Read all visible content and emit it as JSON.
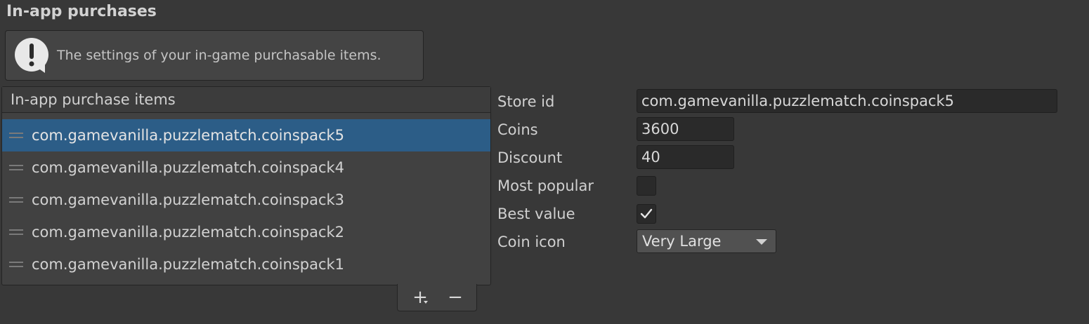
{
  "section": {
    "title": "In-app purchases"
  },
  "help": {
    "icon": "exclamation-speech-bubble-icon",
    "message": "The settings of your in-game purchasable items."
  },
  "list": {
    "header": "In-app purchase items",
    "items": [
      {
        "label": "com.gamevanilla.puzzlematch.coinspack5",
        "selected": true
      },
      {
        "label": "com.gamevanilla.puzzlematch.coinspack4",
        "selected": false
      },
      {
        "label": "com.gamevanilla.puzzlematch.coinspack3",
        "selected": false
      },
      {
        "label": "com.gamevanilla.puzzlematch.coinspack2",
        "selected": false
      },
      {
        "label": "com.gamevanilla.puzzlematch.coinspack1",
        "selected": false
      }
    ],
    "add_label": "+",
    "remove_label": "−"
  },
  "details": {
    "store_id": {
      "label": "Store id",
      "value": "com.gamevanilla.puzzlematch.coinspack5"
    },
    "coins": {
      "label": "Coins",
      "value": "3600"
    },
    "discount": {
      "label": "Discount",
      "value": "40"
    },
    "most_popular": {
      "label": "Most popular",
      "checked": false
    },
    "best_value": {
      "label": "Best value",
      "checked": true
    },
    "coin_icon": {
      "label": "Coin icon",
      "value": "Very Large"
    }
  },
  "colors": {
    "background": "#383838",
    "selection": "#2c5d87",
    "field": "#2a2a2a"
  }
}
